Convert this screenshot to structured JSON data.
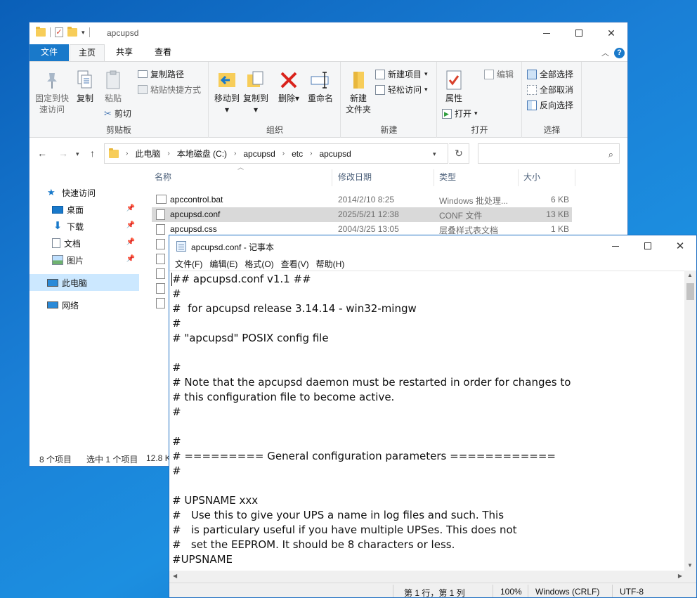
{
  "explorer": {
    "title": "apcupsd",
    "ribbon_tabs": [
      "文件",
      "主页",
      "共享",
      "查看"
    ],
    "clipboard": {
      "pin_label": "固定到快\n速访问",
      "copy_label": "复制",
      "paste_label": "粘贴",
      "copy_path_label": "复制路径",
      "paste_shortcut_label": "粘贴快捷方式",
      "cut_label": "剪切",
      "group_label": "剪贴板"
    },
    "organize": {
      "move_to_label": "移动到",
      "copy_to_label": "复制到",
      "delete_label": "删除",
      "rename_label": "重命名",
      "group_label": "组织"
    },
    "new": {
      "new_folder_label": "新建\n文件夹",
      "new_item_label": "新建项目",
      "easy_access_label": "轻松访问",
      "group_label": "新建"
    },
    "open": {
      "properties_label": "属性",
      "open_label": "打开",
      "edit_label": "编辑",
      "group_label": "打开"
    },
    "select": {
      "select_all_label": "全部选择",
      "select_none_label": "全部取消",
      "invert_label": "反向选择",
      "group_label": "选择"
    },
    "breadcrumb": [
      "此电脑",
      "本地磁盘 (C:)",
      "apcupsd",
      "etc",
      "apcupsd"
    ],
    "search_placeholder": "",
    "nav": [
      {
        "label": "快速访问"
      },
      {
        "label": "桌面"
      },
      {
        "label": "下载"
      },
      {
        "label": "文档"
      },
      {
        "label": "图片"
      },
      {
        "label": "此电脑"
      },
      {
        "label": "网络"
      }
    ],
    "columns": [
      "名称",
      "修改日期",
      "类型",
      "大小"
    ],
    "files": [
      {
        "name": "apccontrol.bat",
        "date": "2014/2/10 8:25",
        "type": "Windows 批处理...",
        "size": "6 KB"
      },
      {
        "name": "apcupsd.conf",
        "date": "2025/5/21 12:38",
        "type": "CONF 文件",
        "size": "13 KB"
      },
      {
        "name": "apcupsd.css",
        "date": "2004/3/25 13:05",
        "type": "层叠样式表文档",
        "size": "1 KB"
      }
    ],
    "status": {
      "count": "8 个项目",
      "selected": "选中 1 个项目",
      "size": "12.8 K"
    }
  },
  "notepad": {
    "title": "apcupsd.conf - 记事本",
    "menu": [
      "文件(F)",
      "编辑(E)",
      "格式(O)",
      "查看(V)",
      "帮助(H)"
    ],
    "lines": [
      "## apcupsd.conf v1.1 ##",
      "#",
      "#  for apcupsd release 3.14.14 - win32-mingw",
      "#",
      "# \"apcupsd\" POSIX config file",
      "",
      "#",
      "# Note that the apcupsd daemon must be restarted in order for changes to",
      "# this configuration file to become active.",
      "#",
      "",
      "#",
      "# ========= General configuration parameters ============",
      "#",
      "",
      "# UPSNAME xxx",
      "#   Use this to give your UPS a name in log files and such. This",
      "#   is particulary useful if you have multiple UPSes. This does not",
      "#   set the EEPROM. It should be 8 characters or less.",
      "#UPSNAME"
    ],
    "status": {
      "position": "第 1 行，第 1 列",
      "zoom": "100%",
      "eol": "Windows (CRLF)",
      "encoding": "UTF-8"
    }
  },
  "colors": {
    "accent": "#1979ca",
    "selection": "#cce8ff",
    "desktop": "#1a7fd6"
  }
}
